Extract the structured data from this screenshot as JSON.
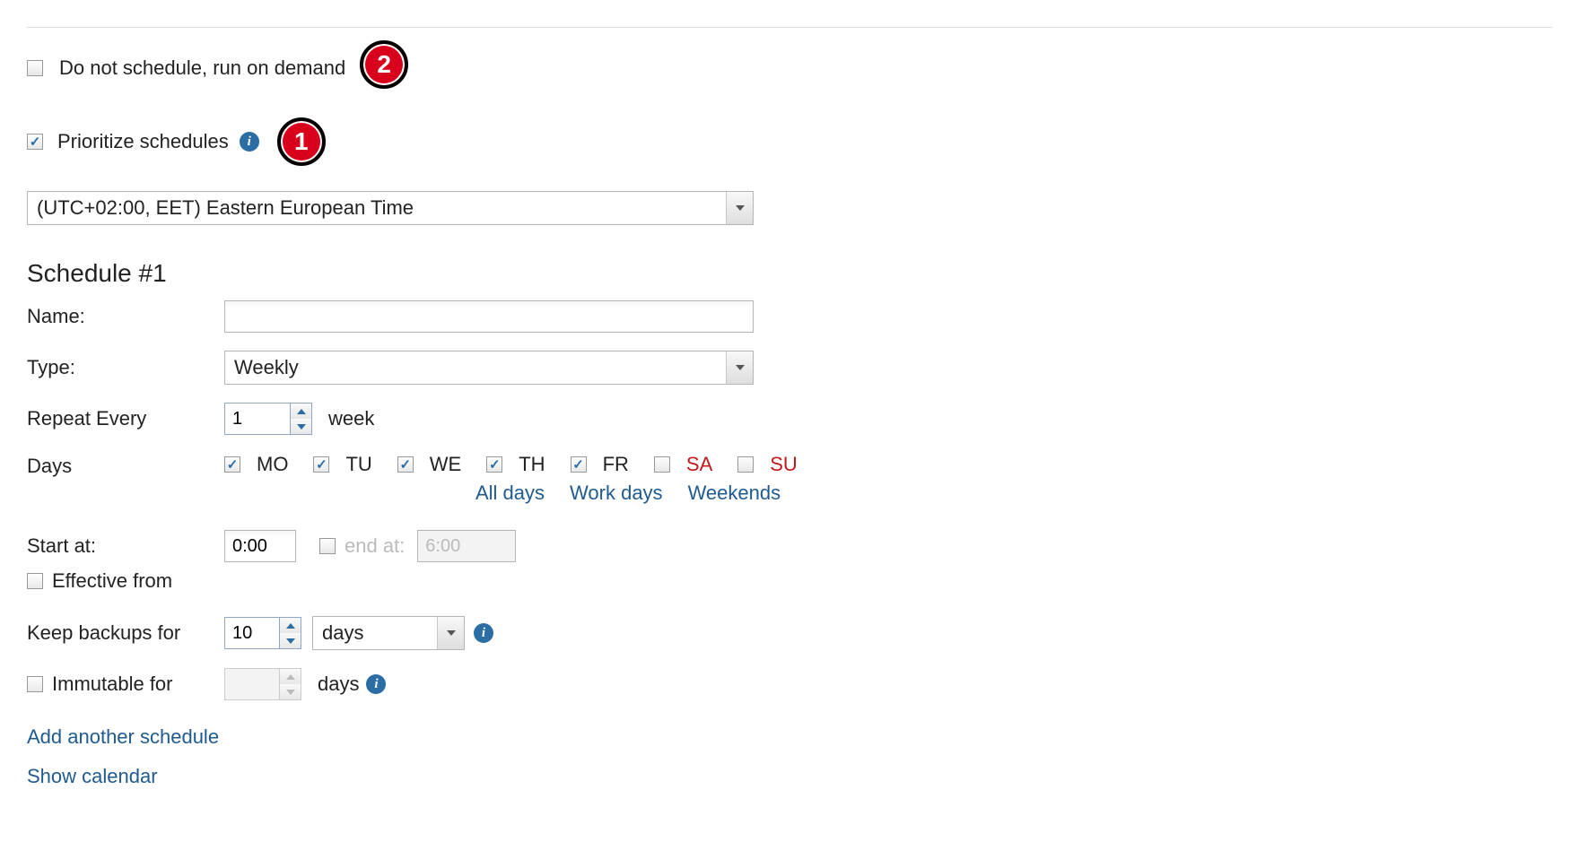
{
  "options": {
    "do_not_schedule": {
      "label": "Do not schedule, run on demand",
      "checked": false
    },
    "prioritize": {
      "label": "Prioritize schedules",
      "checked": true
    }
  },
  "annotations": {
    "one": "1",
    "two": "2"
  },
  "timezone": {
    "value": "(UTC+02:00, EET) Eastern European Time"
  },
  "schedule": {
    "title": "Schedule #1",
    "name": {
      "label": "Name:",
      "value": ""
    },
    "type": {
      "label": "Type:",
      "value": "Weekly"
    },
    "repeat": {
      "label": "Repeat Every",
      "value": "1",
      "unit": "week"
    },
    "days": {
      "label": "Days",
      "items": [
        {
          "code": "MO",
          "checked": true,
          "weekend": false
        },
        {
          "code": "TU",
          "checked": true,
          "weekend": false
        },
        {
          "code": "WE",
          "checked": true,
          "weekend": false
        },
        {
          "code": "TH",
          "checked": true,
          "weekend": false
        },
        {
          "code": "FR",
          "checked": true,
          "weekend": false
        },
        {
          "code": "SA",
          "checked": false,
          "weekend": true
        },
        {
          "code": "SU",
          "checked": false,
          "weekend": true
        }
      ],
      "quick": {
        "all": "All days",
        "work": "Work days",
        "weekends": "Weekends"
      }
    },
    "start": {
      "label": "Start at:",
      "value": "0:00"
    },
    "end": {
      "label": "end at:",
      "value": "6:00",
      "enabled": false
    },
    "effective_from": {
      "label": "Effective from",
      "checked": false
    },
    "keep": {
      "label": "Keep backups for",
      "value": "10",
      "unit": "days"
    },
    "immutable": {
      "label": "Immutable for",
      "checked": false,
      "value": "",
      "unit": "days"
    }
  },
  "links": {
    "add_schedule": "Add another schedule",
    "show_calendar": "Show calendar"
  }
}
